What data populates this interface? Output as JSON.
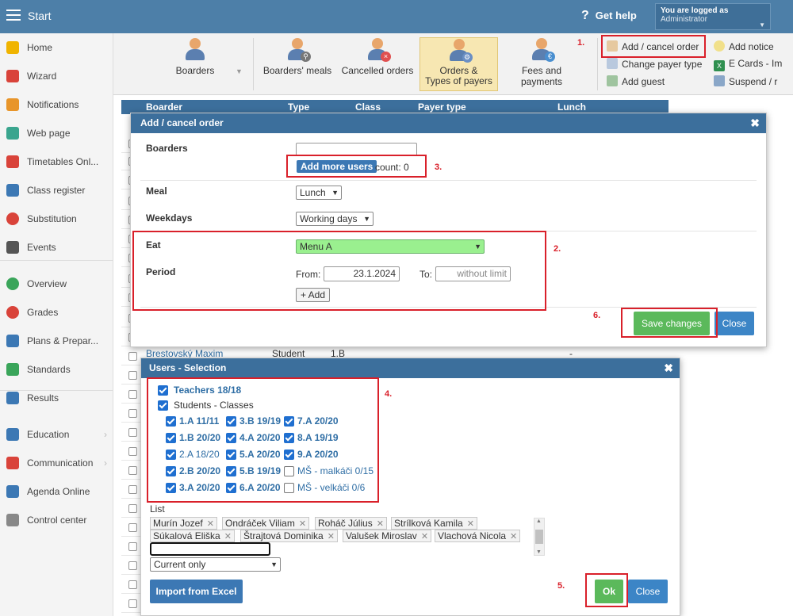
{
  "topbar": {
    "start": "Start",
    "help": "Get help",
    "logged_in": "You are logged as",
    "user": "Administrator"
  },
  "sidebar": [
    {
      "label": "Home",
      "icon": "star-icon",
      "color": "#f0b400"
    },
    {
      "label": "Wizard",
      "icon": "wand-icon",
      "color": "#d9433a"
    },
    {
      "label": "Notifications",
      "icon": "envelope-icon",
      "color": "#e8952a"
    },
    {
      "label": "Web page",
      "icon": "house-icon",
      "color": "#3aa58e"
    },
    {
      "label": "Timetables Onl...",
      "icon": "timetable-icon",
      "color": "#d9433a"
    },
    {
      "label": "Class register",
      "icon": "book-icon",
      "color": "#3c78b4"
    },
    {
      "label": "Substitution",
      "icon": "person-icon",
      "color": "#d9433a"
    },
    {
      "label": "Events",
      "icon": "calendar-icon",
      "color": "#555555"
    },
    {
      "label": "Overview",
      "icon": "check-circle-icon",
      "color": "#3aa55a"
    },
    {
      "label": "Grades",
      "icon": "chart-circle-icon",
      "color": "#d9433a"
    },
    {
      "label": "Plans & Prepar...",
      "icon": "plans-icon",
      "color": "#3c78b4"
    },
    {
      "label": "Standards",
      "icon": "shield-icon",
      "color": "#3aa55a"
    },
    {
      "label": "Results",
      "icon": "bar-chart-icon",
      "color": "#3c78b4"
    },
    {
      "label": "Education",
      "icon": "education-icon",
      "color": "#3c78b4"
    },
    {
      "label": "Communication",
      "icon": "chat-icon",
      "color": "#d9433a"
    },
    {
      "label": "Agenda Online",
      "icon": "pen-icon",
      "color": "#3c78b4"
    },
    {
      "label": "Control center",
      "icon": "gear-icon",
      "color": "#888888"
    }
  ],
  "ribbon": {
    "boarders": "Boarders",
    "meals": "Boarders' meals",
    "cancelled": "Cancelled orders",
    "orders": "Orders &",
    "orders2": "Types of payers",
    "fees": "Fees and payments",
    "add_cancel": "Add / cancel order",
    "change_payer": "Change payer type",
    "add_guest": "Add guest",
    "add_notice": "Add notice",
    "ecards": "E Cards - Im",
    "suspend": "Suspend / r"
  },
  "table": {
    "columns": [
      "Boarder",
      "Type",
      "Class",
      "Payer type",
      "Lunch"
    ],
    "row_name": "Brestovský Maxim",
    "row_type": "Student",
    "row_class": "1.B",
    "row_lunch": "-"
  },
  "modal1": {
    "title": "Add / cancel order",
    "boarders_label": "Boarders",
    "add_more": "Add more users",
    "count": "count: 0",
    "meal_label": "Meal",
    "meal_value": "Lunch",
    "weekdays_label": "Weekdays",
    "weekdays_value": "Working days",
    "eat_label": "Eat",
    "eat_value": "Menu A",
    "period_label": "Period",
    "from_label": "From:",
    "from_value": "23.1.2024",
    "to_label": "To:",
    "to_placeholder": "without limit",
    "add_btn": "+ Add",
    "save": "Save changes",
    "close": "Close"
  },
  "modal2": {
    "title": "Users - Selection",
    "teachers": "Teachers 18/18",
    "students": "Students - Classes",
    "classes": [
      [
        "1.A 11/11",
        "3.B 19/19",
        "7.A 20/20"
      ],
      [
        "1.B 20/20",
        "4.A 20/20",
        "8.A 19/19"
      ],
      [
        "2.A 18/20",
        "5.A 20/20",
        "9.A 20/20"
      ],
      [
        "2.B 20/20",
        "5.B 19/19",
        "MŠ - malkáči 0/15"
      ],
      [
        "3.A 20/20",
        "6.A 20/20",
        "MŠ - velkáči 0/6"
      ]
    ],
    "list_label": "List",
    "tags_row1": [
      "Murín Jozef",
      "Ondráček Viliam",
      "Roháč Július",
      "Strílková Kamila"
    ],
    "tags_row2": [
      "Súkalová Eliška",
      "Štrajtová Dominika",
      "Valušek Miroslav",
      "Vlachová Nicola"
    ],
    "filter": "Current only",
    "import": "Import from Excel",
    "ok": "Ok",
    "close": "Close"
  },
  "annotations": [
    "1.",
    "2.",
    "3.",
    "4.",
    "5.",
    "6."
  ]
}
